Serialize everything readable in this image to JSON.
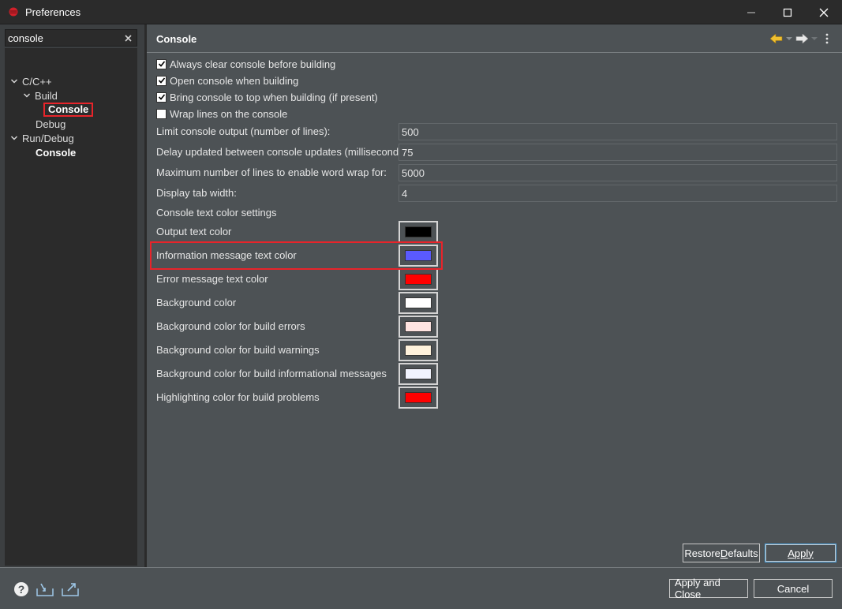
{
  "window": {
    "title": "Preferences",
    "icon": "eclipse-app-icon",
    "controls": [
      "minimize-icon",
      "maximize-icon",
      "close-icon"
    ]
  },
  "sidebar": {
    "filter_value": "console",
    "tree": [
      {
        "label": "C/C++",
        "expanded": true
      },
      {
        "label": "Build",
        "expanded": true
      },
      {
        "label": "Console",
        "selected": true
      },
      {
        "label": "Debug"
      },
      {
        "label": "Run/Debug",
        "expanded": true
      },
      {
        "label": "Console"
      }
    ]
  },
  "page": {
    "title": "Console",
    "checkboxes": [
      {
        "label": "Always clear console before building",
        "checked": true
      },
      {
        "label": "Open console when building",
        "checked": true
      },
      {
        "label": "Bring console to top when building (if present)",
        "checked": true
      },
      {
        "label": "Wrap lines on the console",
        "checked": false
      }
    ],
    "fields": [
      {
        "label": "Limit console output (number of lines):",
        "value": "500"
      },
      {
        "label": "Delay updated between console updates (milliseconds):",
        "value": "75"
      },
      {
        "label": "Maximum number of lines to enable word wrap for:",
        "value": "5000"
      },
      {
        "label": "Display tab width:",
        "value": "4"
      }
    ],
    "color_section_label": "Console text color settings",
    "colors": [
      {
        "label": "Output text color",
        "color": "#000000"
      },
      {
        "label": "Information message text color",
        "color": "#5a5aff"
      },
      {
        "label": "Error message text color",
        "color": "#ff0000"
      },
      {
        "label": "Background color",
        "color": "#ffffff"
      },
      {
        "label": "Background color for build errors",
        "color": "#ffe4e1"
      },
      {
        "label": "Background color for build warnings",
        "color": "#fff2dc"
      },
      {
        "label": "Background color for build informational messages",
        "color": "#f2f4ff"
      },
      {
        "label": "Highlighting color for build problems",
        "color": "#ff0000"
      }
    ],
    "restore_defaults_pre": "Restore ",
    "restore_defaults_mnemonic": "D",
    "restore_defaults_post": "efaults",
    "apply_mnemonic": "A",
    "apply_post": "pply"
  },
  "footer": {
    "apply_close_label": "Apply and Close",
    "cancel_label": "Cancel",
    "icons": [
      "help-icon",
      "import-icon",
      "export-icon"
    ]
  },
  "colors": {
    "highlight": "#e8242a",
    "nav_back": "#f0c030"
  }
}
